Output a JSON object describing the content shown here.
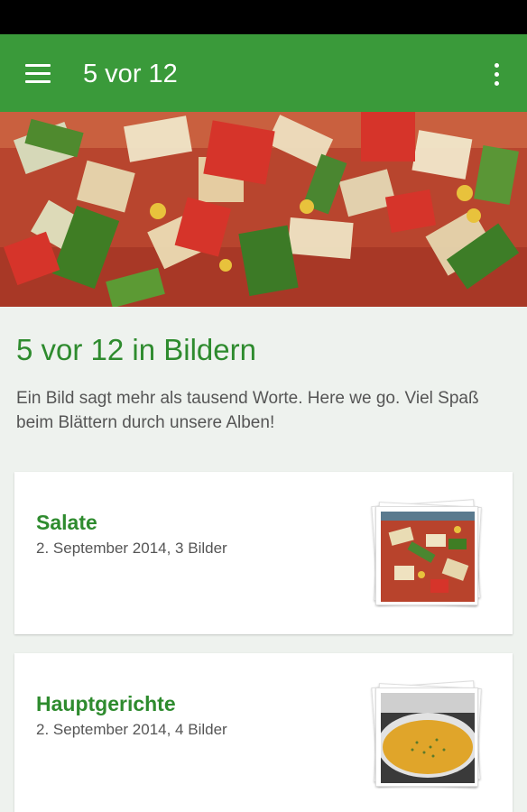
{
  "app_bar": {
    "title": "5 vor 12",
    "menu_icon": "hamburger-menu-icon",
    "overflow_icon": "more-vert-icon",
    "color": "#3a9a3a"
  },
  "hero": {
    "image": "salad-photo"
  },
  "section": {
    "title": "5 vor 12 in Bildern",
    "description": "Ein Bild sagt mehr als tausend Worte. Here we go. Viel Spaß beim Blättern durch unsere Alben!"
  },
  "albums": [
    {
      "title": "Salate",
      "meta": "2. September 2014, 3 Bilder",
      "thumbnail": "salad-thumbnail"
    },
    {
      "title": "Hauptgerichte",
      "meta": "2. September 2014, 4 Bilder",
      "thumbnail": "soup-thumbnail"
    }
  ],
  "colors": {
    "accent": "#2e8b2e",
    "background": "#eef2ee"
  }
}
